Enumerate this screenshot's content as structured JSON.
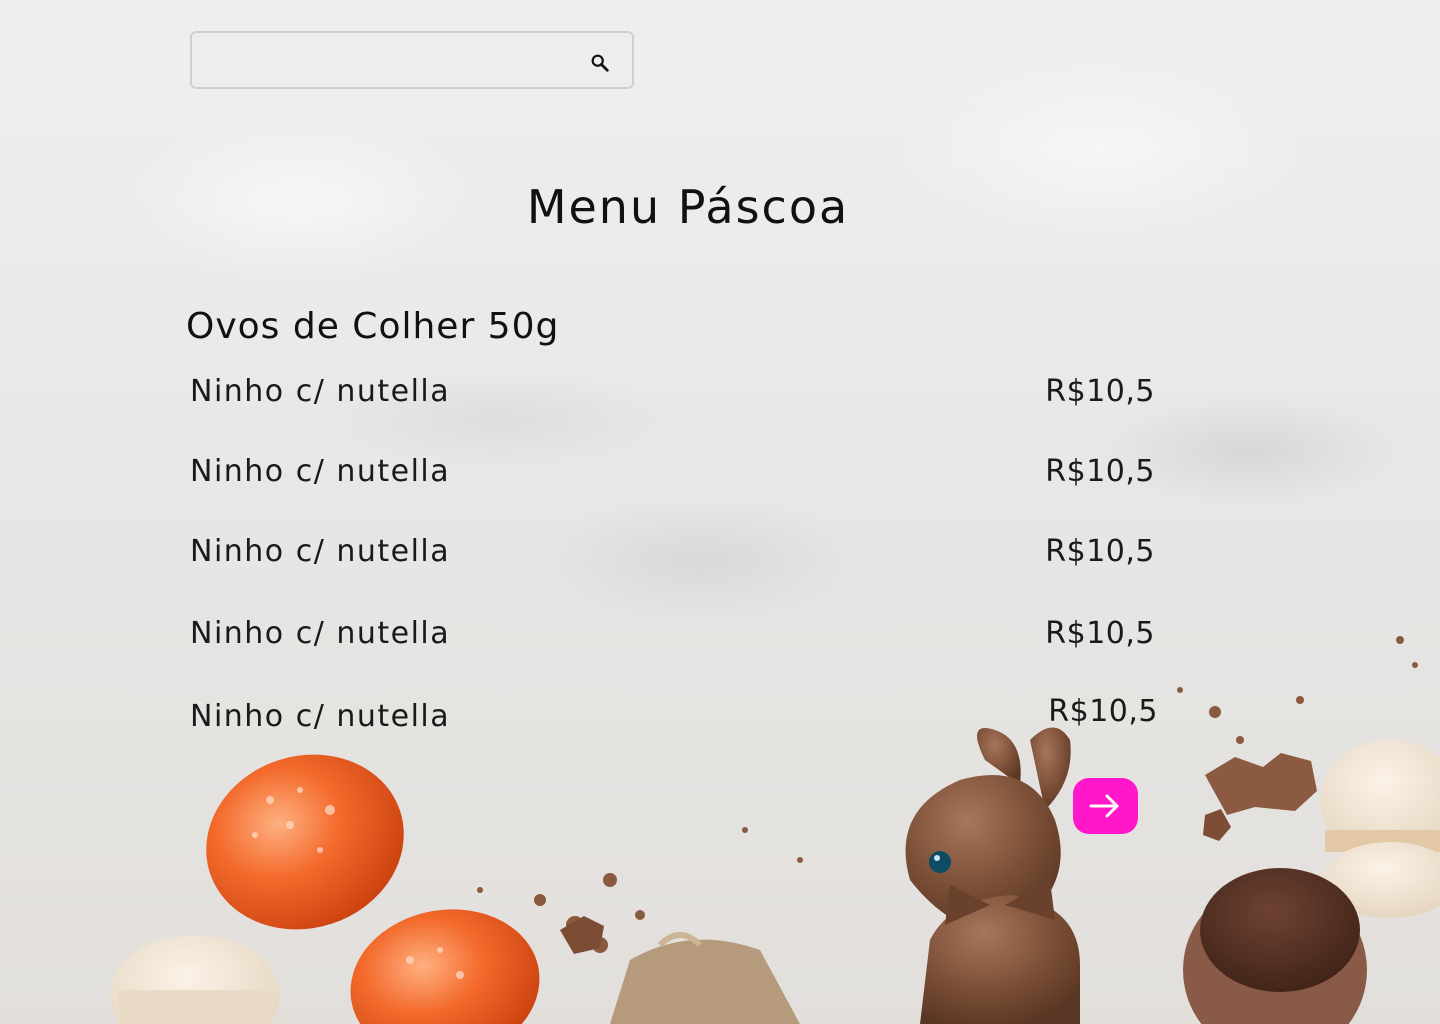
{
  "search": {
    "value": "",
    "placeholder": ""
  },
  "icons": {
    "search": "search-icon",
    "next": "arrow-right-icon"
  },
  "page_title": "Menu Páscoa",
  "section": {
    "title": "Ovos de Colher 50g",
    "items": [
      {
        "name": "Ninho c/ nutella",
        "price": "R$10,5"
      },
      {
        "name": "Ninho c/ nutella",
        "price": "R$10,5"
      },
      {
        "name": "Ninho c/ nutella",
        "price": "R$10,5"
      },
      {
        "name": "Ninho c/ nutella",
        "price": "R$10,5"
      },
      {
        "name": "Ninho c/ nutella",
        "price": "R$10,5"
      }
    ]
  },
  "colors": {
    "accent": "#ff17c9",
    "text": "#111111",
    "border": "#cfcfcf"
  }
}
